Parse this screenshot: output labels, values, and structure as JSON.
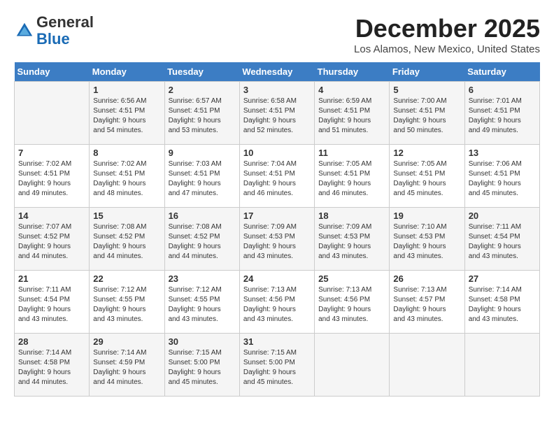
{
  "header": {
    "logo_general": "General",
    "logo_blue": "Blue",
    "month_title": "December 2025",
    "location": "Los Alamos, New Mexico, United States"
  },
  "weekdays": [
    "Sunday",
    "Monday",
    "Tuesday",
    "Wednesday",
    "Thursday",
    "Friday",
    "Saturday"
  ],
  "weeks": [
    [
      {
        "day": "",
        "info": ""
      },
      {
        "day": "1",
        "info": "Sunrise: 6:56 AM\nSunset: 4:51 PM\nDaylight: 9 hours\nand 54 minutes."
      },
      {
        "day": "2",
        "info": "Sunrise: 6:57 AM\nSunset: 4:51 PM\nDaylight: 9 hours\nand 53 minutes."
      },
      {
        "day": "3",
        "info": "Sunrise: 6:58 AM\nSunset: 4:51 PM\nDaylight: 9 hours\nand 52 minutes."
      },
      {
        "day": "4",
        "info": "Sunrise: 6:59 AM\nSunset: 4:51 PM\nDaylight: 9 hours\nand 51 minutes."
      },
      {
        "day": "5",
        "info": "Sunrise: 7:00 AM\nSunset: 4:51 PM\nDaylight: 9 hours\nand 50 minutes."
      },
      {
        "day": "6",
        "info": "Sunrise: 7:01 AM\nSunset: 4:51 PM\nDaylight: 9 hours\nand 49 minutes."
      }
    ],
    [
      {
        "day": "7",
        "info": "Sunrise: 7:02 AM\nSunset: 4:51 PM\nDaylight: 9 hours\nand 49 minutes."
      },
      {
        "day": "8",
        "info": "Sunrise: 7:02 AM\nSunset: 4:51 PM\nDaylight: 9 hours\nand 48 minutes."
      },
      {
        "day": "9",
        "info": "Sunrise: 7:03 AM\nSunset: 4:51 PM\nDaylight: 9 hours\nand 47 minutes."
      },
      {
        "day": "10",
        "info": "Sunrise: 7:04 AM\nSunset: 4:51 PM\nDaylight: 9 hours\nand 46 minutes."
      },
      {
        "day": "11",
        "info": "Sunrise: 7:05 AM\nSunset: 4:51 PM\nDaylight: 9 hours\nand 46 minutes."
      },
      {
        "day": "12",
        "info": "Sunrise: 7:05 AM\nSunset: 4:51 PM\nDaylight: 9 hours\nand 45 minutes."
      },
      {
        "day": "13",
        "info": "Sunrise: 7:06 AM\nSunset: 4:51 PM\nDaylight: 9 hours\nand 45 minutes."
      }
    ],
    [
      {
        "day": "14",
        "info": "Sunrise: 7:07 AM\nSunset: 4:52 PM\nDaylight: 9 hours\nand 44 minutes."
      },
      {
        "day": "15",
        "info": "Sunrise: 7:08 AM\nSunset: 4:52 PM\nDaylight: 9 hours\nand 44 minutes."
      },
      {
        "day": "16",
        "info": "Sunrise: 7:08 AM\nSunset: 4:52 PM\nDaylight: 9 hours\nand 44 minutes."
      },
      {
        "day": "17",
        "info": "Sunrise: 7:09 AM\nSunset: 4:53 PM\nDaylight: 9 hours\nand 43 minutes."
      },
      {
        "day": "18",
        "info": "Sunrise: 7:09 AM\nSunset: 4:53 PM\nDaylight: 9 hours\nand 43 minutes."
      },
      {
        "day": "19",
        "info": "Sunrise: 7:10 AM\nSunset: 4:53 PM\nDaylight: 9 hours\nand 43 minutes."
      },
      {
        "day": "20",
        "info": "Sunrise: 7:11 AM\nSunset: 4:54 PM\nDaylight: 9 hours\nand 43 minutes."
      }
    ],
    [
      {
        "day": "21",
        "info": "Sunrise: 7:11 AM\nSunset: 4:54 PM\nDaylight: 9 hours\nand 43 minutes."
      },
      {
        "day": "22",
        "info": "Sunrise: 7:12 AM\nSunset: 4:55 PM\nDaylight: 9 hours\nand 43 minutes."
      },
      {
        "day": "23",
        "info": "Sunrise: 7:12 AM\nSunset: 4:55 PM\nDaylight: 9 hours\nand 43 minutes."
      },
      {
        "day": "24",
        "info": "Sunrise: 7:13 AM\nSunset: 4:56 PM\nDaylight: 9 hours\nand 43 minutes."
      },
      {
        "day": "25",
        "info": "Sunrise: 7:13 AM\nSunset: 4:56 PM\nDaylight: 9 hours\nand 43 minutes."
      },
      {
        "day": "26",
        "info": "Sunrise: 7:13 AM\nSunset: 4:57 PM\nDaylight: 9 hours\nand 43 minutes."
      },
      {
        "day": "27",
        "info": "Sunrise: 7:14 AM\nSunset: 4:58 PM\nDaylight: 9 hours\nand 43 minutes."
      }
    ],
    [
      {
        "day": "28",
        "info": "Sunrise: 7:14 AM\nSunset: 4:58 PM\nDaylight: 9 hours\nand 44 minutes."
      },
      {
        "day": "29",
        "info": "Sunrise: 7:14 AM\nSunset: 4:59 PM\nDaylight: 9 hours\nand 44 minutes."
      },
      {
        "day": "30",
        "info": "Sunrise: 7:15 AM\nSunset: 5:00 PM\nDaylight: 9 hours\nand 45 minutes."
      },
      {
        "day": "31",
        "info": "Sunrise: 7:15 AM\nSunset: 5:00 PM\nDaylight: 9 hours\nand 45 minutes."
      },
      {
        "day": "",
        "info": ""
      },
      {
        "day": "",
        "info": ""
      },
      {
        "day": "",
        "info": ""
      }
    ]
  ]
}
